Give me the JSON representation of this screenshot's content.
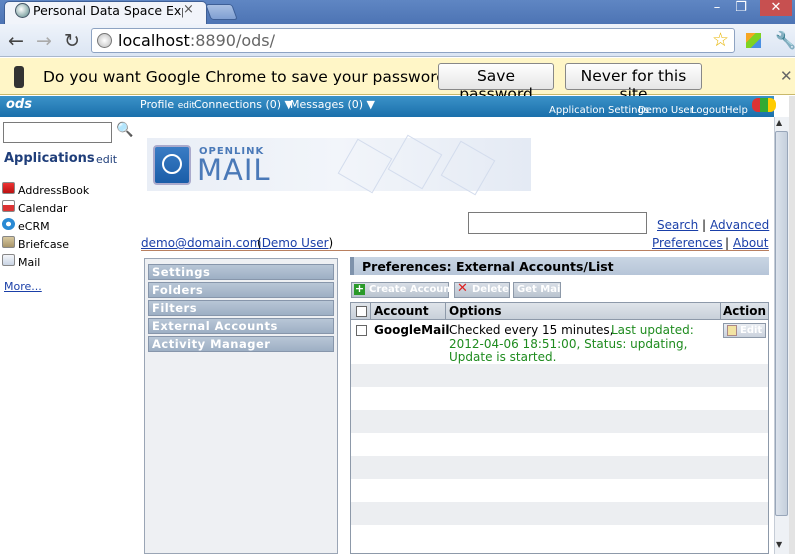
{
  "browser": {
    "tab_title": "Personal Data Space Expl",
    "tab_close": "×",
    "url_host": "localhost",
    "url_path": ":8890/ods/",
    "win_min": "–",
    "win_max": "❐",
    "win_close": "✕"
  },
  "infobar": {
    "text": "Do you want Google Chrome to save your password?",
    "save_label": "Save password",
    "never_label": "Never for this site",
    "close": "✕"
  },
  "ods_bar": {
    "logo": "ods",
    "profile": "Profile",
    "profile_edit": "edit",
    "connections": "Connections (0) ▼",
    "messages": "Messages (0) ▼",
    "app_settings": "Application Settings",
    "user": "Demo User",
    "logout": "Logout",
    "help": "Help"
  },
  "sidebar": {
    "apps_title": "Applications",
    "apps_edit": "edit",
    "items": [
      {
        "label": "AddressBook"
      },
      {
        "label": "Calendar"
      },
      {
        "label": "eCRM"
      },
      {
        "label": "Briefcase"
      },
      {
        "label": "Mail"
      }
    ],
    "more": "More..."
  },
  "banner": {
    "openlink": "OPENLINK",
    "mail": "MAIL"
  },
  "search": {
    "search_link": "Search",
    "separator": "|",
    "advanced_link": "Advanced"
  },
  "user_line": {
    "email": "demo@domain.com",
    "user_name": "Demo User",
    "preferences": "Preferences",
    "about": "About"
  },
  "pref_nav": {
    "items": [
      {
        "label": "Settings"
      },
      {
        "label": "Folders"
      },
      {
        "label": "Filters"
      },
      {
        "label": "External Accounts"
      },
      {
        "label": "Activity Manager"
      }
    ]
  },
  "panel": {
    "title": "Preferences: External Accounts/List",
    "create_label": "Create Account",
    "delete_label": "Delete",
    "getmail_label": "Get Mail",
    "columns": {
      "account": "Account",
      "options": "Options",
      "action": "Action"
    },
    "rows": [
      {
        "account": "GoogleMail",
        "options_prefix": "Checked every 15 minutes,",
        "options_line1_green": "Last updated:",
        "options_line2": "2012-04-06 18:51:00, Status: updating,",
        "options_line3": "Update is started.",
        "action": "Edit"
      }
    ]
  },
  "colors": {
    "ods_bar": "#1a6fab",
    "link": "#1a3fa8",
    "status_green": "#1e8b1e"
  }
}
